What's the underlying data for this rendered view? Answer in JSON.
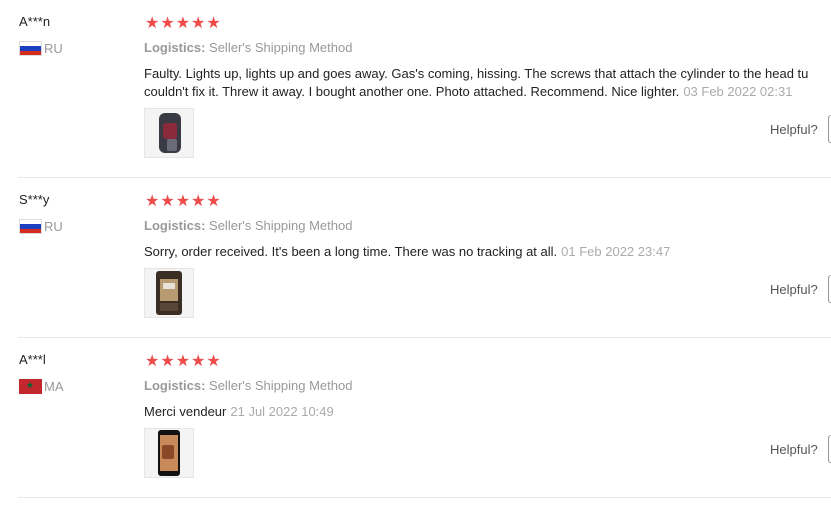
{
  "reviews": [
    {
      "user": "A***n",
      "country": "RU",
      "flag": "ru-flag",
      "rating": "★★★★★",
      "logistics_label": "Logistics:",
      "logistics_value": "Seller's Shipping Method",
      "text_line1": "Faulty. Lights up, lights up and goes away. Gas's coming, hissing. The screws that attach the cylinder to the head tu",
      "text_line2": "couldn't fix it. Threw it away. I bought another one. Photo attached. Recommend. Nice lighter.",
      "date": "03 Feb 2022 02:31",
      "helpful_label": "Helpful?"
    },
    {
      "user": "S***y",
      "country": "RU",
      "flag": "ru-flag",
      "rating": "★★★★★",
      "logistics_label": "Logistics:",
      "logistics_value": "Seller's Shipping Method",
      "text_line1": "Sorry, order received. It's been a long time. There was no tracking at all.",
      "date": "01 Feb 2022 23:47",
      "helpful_label": "Helpful?"
    },
    {
      "user": "A***l",
      "country": "MA",
      "flag": "ma-flag",
      "rating": "★★★★★",
      "logistics_label": "Logistics:",
      "logistics_value": "Seller's Shipping Method",
      "text_line1": "Merci vendeur",
      "date": "21 Jul 2022 10:49",
      "helpful_label": "Helpful?"
    }
  ]
}
